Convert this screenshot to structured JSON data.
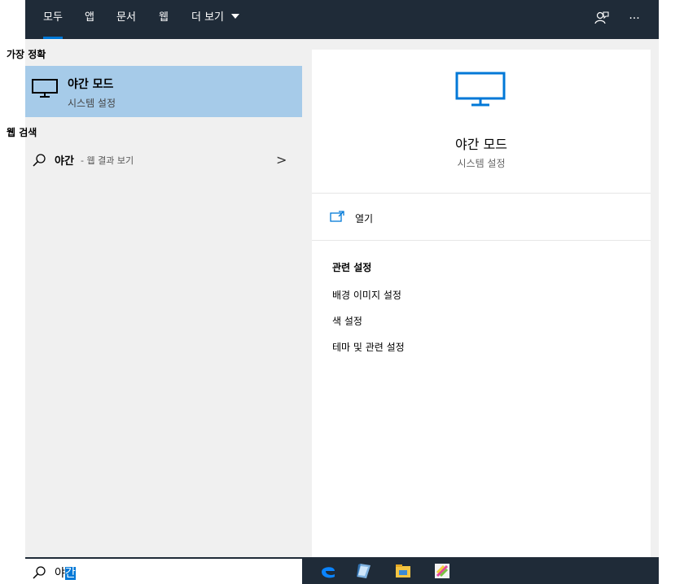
{
  "nav": {
    "tabs": [
      {
        "label": "모두"
      },
      {
        "label": "앱"
      },
      {
        "label": "문서"
      },
      {
        "label": "웹"
      },
      {
        "label": "더 보기"
      }
    ],
    "active_tab": "모두",
    "icons": [
      "feedback-icon",
      "more-icon"
    ],
    "more_icon_glyph": "···"
  },
  "left": {
    "best_match_heading": "가장 정확",
    "best_match": {
      "title": "야간 모드",
      "subtitle": "시스템 설정",
      "icon": "monitor-icon"
    },
    "web_heading": "웹 검색",
    "web_result": {
      "query": "야간",
      "suffix": "- 웹 결과 보기",
      "chevron": ">"
    }
  },
  "detail": {
    "icon": "monitor-icon",
    "title": "야간 모드",
    "subtitle": "시스템 설정",
    "open_label": "열기",
    "related_heading": "관련 설정",
    "related": [
      "배경 이미지 설정",
      "색 설정",
      "테마 및 관련 설정"
    ]
  },
  "search": {
    "value_plain": "야",
    "value_selected": "간"
  },
  "taskbar": {
    "apps": [
      "edge-icon",
      "notepad-icon",
      "file-explorer-icon",
      "sticky-notes-icon"
    ]
  },
  "colors": {
    "topbar": "#1f2b38",
    "accent": "#0078d7",
    "selection": "#a6cbe9",
    "panel": "#f0f0f0"
  }
}
